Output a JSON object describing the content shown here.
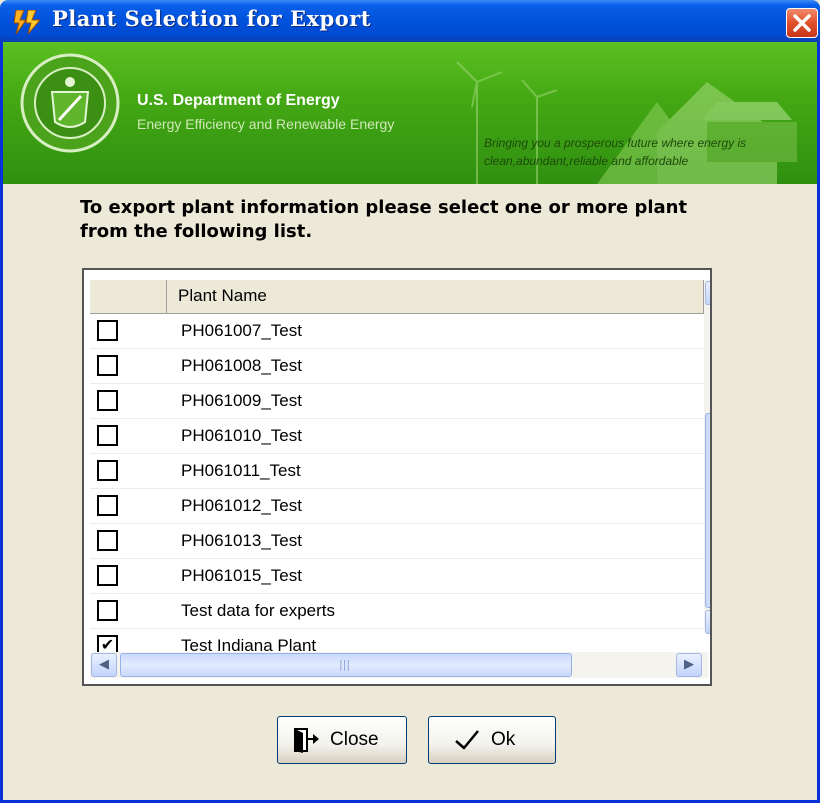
{
  "window": {
    "title": "Plant Selection for Export",
    "close_label": "×"
  },
  "banner": {
    "department": "U.S. Department of Energy",
    "office": "Energy Efficiency and Renewable Energy",
    "tagline_line1": "Bringing you a prosperous future where energy is",
    "tagline_line2": "clean,abundant,reliable and affordable"
  },
  "instruction": "To export plant information please select one or more plant from the following list.",
  "grid": {
    "column_header": "Plant Name",
    "rows": [
      {
        "name": "PH061007_Test",
        "checked": false,
        "mark": ""
      },
      {
        "name": "PH061008_Test",
        "checked": false,
        "mark": ""
      },
      {
        "name": "PH061009_Test",
        "checked": false,
        "mark": ""
      },
      {
        "name": "PH061010_Test",
        "checked": false,
        "mark": ""
      },
      {
        "name": "PH061011_Test",
        "checked": false,
        "mark": ""
      },
      {
        "name": "PH061012_Test",
        "checked": false,
        "mark": ""
      },
      {
        "name": "PH061013_Test",
        "checked": false,
        "mark": ""
      },
      {
        "name": "PH061015_Test",
        "checked": false,
        "mark": ""
      },
      {
        "name": "Test data for experts",
        "checked": false,
        "mark": ""
      },
      {
        "name": "Test Indiana Plant",
        "checked": true,
        "mark": "✔"
      }
    ]
  },
  "scrollbars": {
    "up_arrow": "▲",
    "down_arrow": "▼",
    "left_arrow": "◀",
    "right_arrow": "▶"
  },
  "buttons": {
    "close_label": "Close",
    "ok_label": "Ok"
  },
  "colors": {
    "titlebar": "#0052dc",
    "banner_green": "#44a814"
  }
}
